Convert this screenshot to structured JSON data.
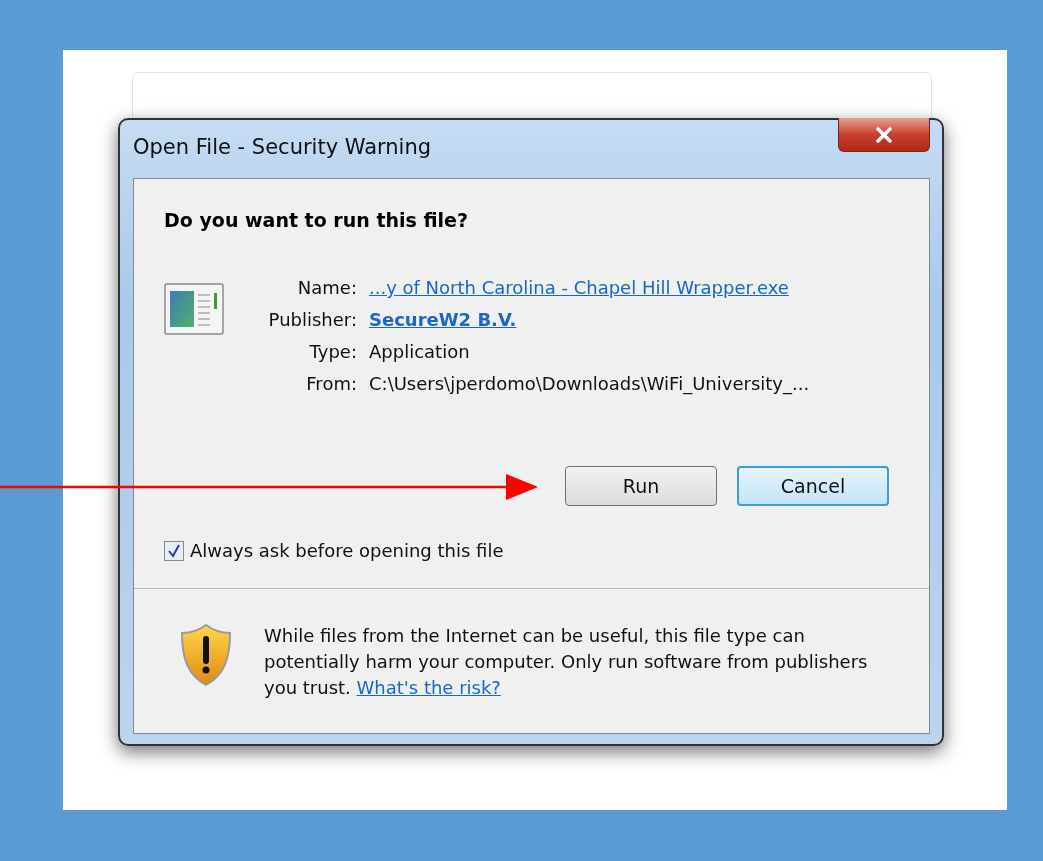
{
  "window": {
    "title": "Open File - Security Warning"
  },
  "heading": "Do you want to run this file?",
  "fields": [
    {
      "label": "Name:",
      "value": "...y of North Carolina - Chapel Hill Wrapper.exe",
      "kind": "link"
    },
    {
      "label": "Publisher:",
      "value": "SecureW2 B.V.",
      "kind": "bold-link"
    },
    {
      "label": "Type:",
      "value": "Application",
      "kind": "text"
    },
    {
      "label": "From:",
      "value": "C:\\Users\\jperdomo\\Downloads\\WiFi_University_...",
      "kind": "text"
    }
  ],
  "buttons": [
    {
      "label": "Run",
      "focused": false
    },
    {
      "label": "Cancel",
      "focused": true
    }
  ],
  "always_ask": {
    "label": "Always ask before opening this file",
    "checked": true
  },
  "warning": {
    "text": "While files from the Internet can be useful, this file type can potentially harm your computer. Only run software from publishers you trust.",
    "link": "What's the risk?"
  }
}
